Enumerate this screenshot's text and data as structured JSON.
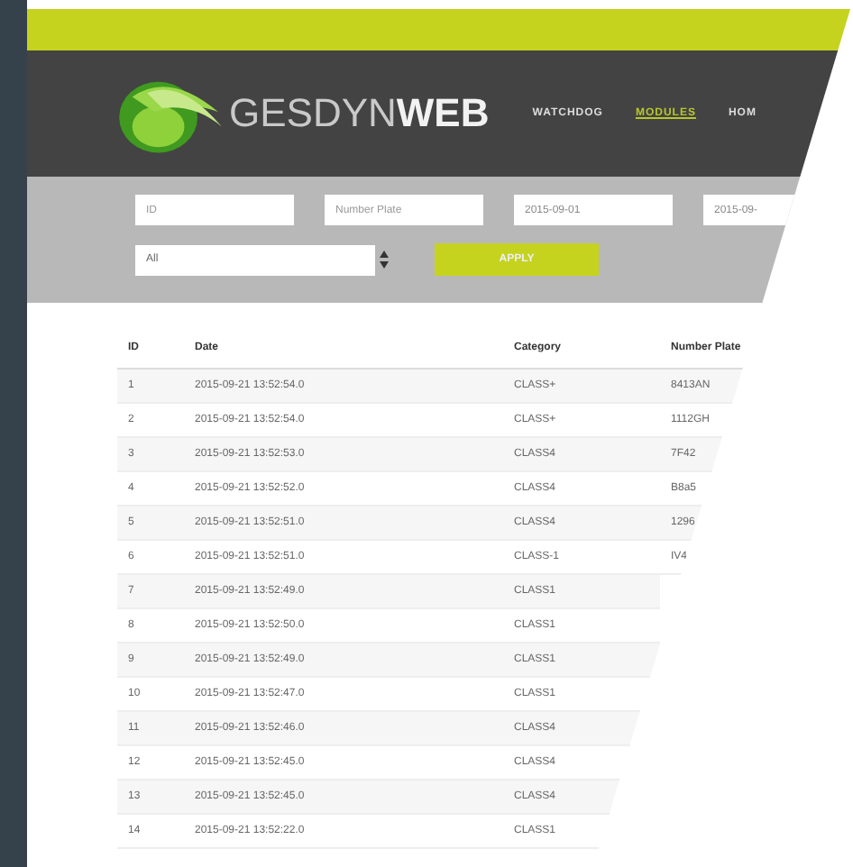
{
  "logo": {
    "name": "GESDYN",
    "bold": "WEB"
  },
  "nav": [
    {
      "label": "WATCHDOG",
      "selected": false
    },
    {
      "label": "MODULES",
      "selected": true
    },
    {
      "label": "HOM",
      "selected": false
    }
  ],
  "filters": {
    "fields": [
      {
        "placeholder": "ID"
      },
      {
        "placeholder": "Number Plate"
      },
      {
        "value": "2015-09-01"
      },
      {
        "value": "2015-09-"
      }
    ],
    "select": "All",
    "apply": "APPLY"
  },
  "table": {
    "columns": [
      "ID",
      "Date",
      "Category",
      "Number Plate"
    ],
    "rows": [
      [
        "1",
        "2015-09-21 13:52:54.0",
        "CLASS+",
        "8413AN"
      ],
      [
        "2",
        "2015-09-21 13:52:54.0",
        "CLASS+",
        "1112GH"
      ],
      [
        "3",
        "2015-09-21 13:52:53.0",
        "CLASS4",
        "7F42"
      ],
      [
        "4",
        "2015-09-21 13:52:52.0",
        "CLASS4",
        "B8a5"
      ],
      [
        "5",
        "2015-09-21 13:52:51.0",
        "CLASS4",
        "1296"
      ],
      [
        "6",
        "2015-09-21 13:52:51.0",
        "CLASS-1",
        "IV4"
      ],
      [
        "7",
        "2015-09-21 13:52:49.0",
        "CLASS1"
      ],
      [
        "8",
        "2015-09-21 13:52:50.0",
        "CLASS1"
      ],
      [
        "9",
        "2015-09-21 13:52:49.0",
        "CLASS1"
      ],
      [
        "10",
        "2015-09-21 13:52:47.0",
        "CLASS1"
      ],
      [
        "11",
        "2015-09-21 13:52:46.0",
        "CLASS4"
      ],
      [
        "12",
        "2015-09-21 13:52:45.0",
        "CLASS4"
      ],
      [
        "13",
        "2015-09-21 13:52:45.0",
        "CLASS4"
      ],
      [
        "14",
        "2015-09-21 13:52:22.0",
        "CLASS1"
      ]
    ]
  }
}
